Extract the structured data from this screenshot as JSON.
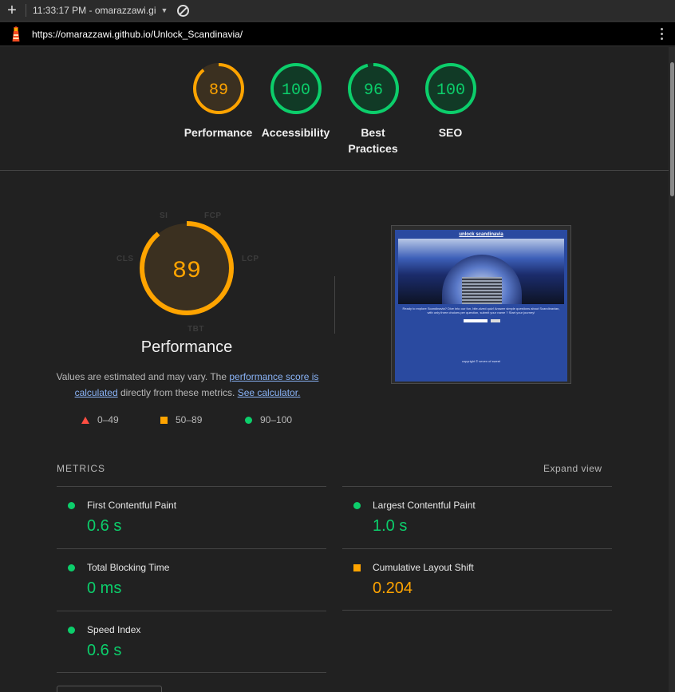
{
  "browser": {
    "new_tab": "+",
    "session_label": "11:33:17 PM - omarazzawi.gi",
    "url": "https://omarazzawi.github.io/Unlock_Scandinavia/"
  },
  "summary_gauges": [
    {
      "score": "89",
      "label": "Performance",
      "status": "average",
      "color": "#ffa400"
    },
    {
      "score": "100",
      "label": "Accessibility",
      "status": "pass",
      "color": "#0cce6b"
    },
    {
      "score": "96",
      "label": "Best Practices",
      "status": "pass",
      "color": "#0cce6b"
    },
    {
      "score": "100",
      "label": "SEO",
      "status": "pass",
      "color": "#0cce6b"
    }
  ],
  "performance": {
    "score": "89",
    "score_fraction": 0.89,
    "radar_labels": {
      "si": "SI",
      "fcp": "FCP",
      "lcp": "LCP",
      "tbt": "TBT",
      "cls": "CLS"
    },
    "title": "Performance",
    "desc_prefix": "Values are estimated and may vary. The ",
    "desc_link1": "performance score is calculated",
    "desc_middle": " directly from these metrics. ",
    "desc_link2": "See calculator."
  },
  "legend": {
    "fail": "0–49",
    "average": "50–89",
    "pass": "90–100"
  },
  "screenshot_preview": {
    "site_title": "unlock scandinavia",
    "site_text": "Ready to explore Scandinavia? Dive into our fun, bite-sized quiz! Answer simple questions about Scandinavian, with only three choices per question, submit your name ? Start your journey!",
    "site_footer": "copyright © seven of sweet"
  },
  "metrics": {
    "heading": "METRICS",
    "expand_label": "Expand view",
    "items": [
      {
        "name": "First Contentful Paint",
        "value": "0.6 s",
        "status": "pass"
      },
      {
        "name": "Largest Contentful Paint",
        "value": "1.0 s",
        "status": "pass"
      },
      {
        "name": "Total Blocking Time",
        "value": "0 ms",
        "status": "pass"
      },
      {
        "name": "Cumulative Layout Shift",
        "value": "0.204",
        "status": "average"
      },
      {
        "name": "Speed Index",
        "value": "0.6 s",
        "status": "pass"
      }
    ]
  },
  "colors": {
    "pass": "#0cce6b",
    "average": "#ffa400",
    "fail": "#ff4e42",
    "background": "#212121",
    "link": "#8ab4f8"
  }
}
